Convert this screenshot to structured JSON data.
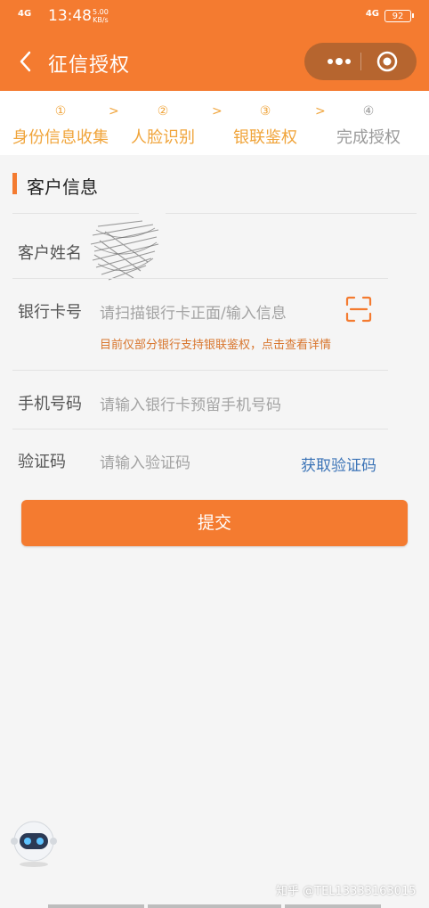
{
  "status": {
    "signal_left": "4G",
    "time": "13:48",
    "speed_value": "5.00",
    "speed_unit": "KB/s",
    "signal_right": "4G",
    "battery": "92"
  },
  "header": {
    "title": "征信授权",
    "back_icon": "chevron-left-icon",
    "more_icon": "more-dots-icon",
    "close_icon": "target-circle-icon"
  },
  "steps": [
    {
      "num": "①",
      "label": "身份信息收集",
      "state": "done"
    },
    {
      "num": "②",
      "label": "人脸识别",
      "state": "done"
    },
    {
      "num": "③",
      "label": "银联鉴权",
      "state": "done"
    },
    {
      "num": "④",
      "label": "完成授权",
      "state": "todo"
    }
  ],
  "step_arrow": ">",
  "section": {
    "title": "客户信息"
  },
  "form": {
    "name_label": "客户姓名",
    "card_label": "银行卡号",
    "card_placeholder": "请扫描银行卡正面/输入信息",
    "card_hint": "目前仅部分银行支持银联鉴权，点击查看详情",
    "phone_label": "手机号码",
    "phone_placeholder": "请输入银行卡预留手机号码",
    "code_label": "验证码",
    "code_placeholder": "请输入验证码",
    "get_code": "获取验证码",
    "submit": "提交"
  },
  "watermark": "知乎 @TEL13333163015",
  "colors": {
    "accent": "#f47b30",
    "step": "#f0a43a",
    "link": "#3c74b7"
  }
}
